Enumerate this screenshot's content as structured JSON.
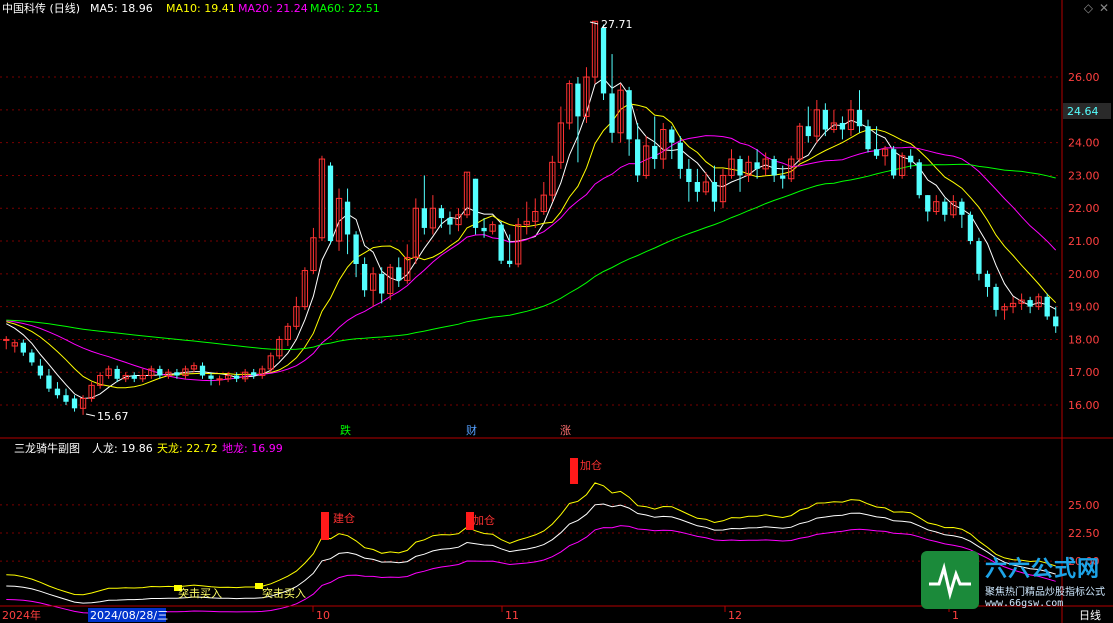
{
  "header": {
    "stock": "中国科传 (日线)",
    "ma5": "MA5: 18.96",
    "ma10": "MA10: 19.41",
    "ma20": "MA20: 21.24",
    "ma60": "MA60: 22.51"
  },
  "sub_header": {
    "name": "三龙骑牛副图",
    "renlong": "人龙: 19.86",
    "tianlong": "天龙: 22.72",
    "dilong": "地龙: 16.99"
  },
  "current_price": "24.64",
  "hi_label": "27.71",
  "lo_label": "15.67",
  "event_markers": [
    "跌",
    "财",
    "涨"
  ],
  "sub_markers": [
    "建仓",
    "加仓",
    "加仓"
  ],
  "buy_labels": [
    "突击买入",
    "突击买入"
  ],
  "axis_dates": [
    "2024年",
    "2024/08/28/三",
    "10",
    "11",
    "12",
    "1"
  ],
  "period_label": "日线",
  "watermark": {
    "title": "六六公式网",
    "subtitle": "聚焦热门精品炒股指标公式",
    "url": "www.66gsw.com"
  },
  "colors": {
    "up": "#ff3232",
    "down": "#54ffff",
    "ma5": "#ffffff",
    "ma10": "#ffff00",
    "ma20": "#ff00ff",
    "ma60": "#00ff00",
    "grid": "#7a0000",
    "axis": "#b40000"
  },
  "chart_data": [
    {
      "type": "candlestick",
      "ylim": [
        15.3,
        27.8
      ],
      "yticks": [
        "26.00",
        "25.00",
        "24.00",
        "23.00",
        "22.00",
        "21.00",
        "20.00",
        "19.00",
        "18.00",
        "17.00",
        "16.00"
      ],
      "candles": [
        [
          18.0,
          18.0,
          18.1,
          17.7
        ],
        [
          17.8,
          17.9,
          18.0,
          17.6
        ],
        [
          17.9,
          17.6,
          18.0,
          17.5
        ],
        [
          17.6,
          17.3,
          17.7,
          17.2
        ],
        [
          17.2,
          16.9,
          17.4,
          16.8
        ],
        [
          16.9,
          16.5,
          17.1,
          16.4
        ],
        [
          16.5,
          16.3,
          16.7,
          16.2
        ],
        [
          16.3,
          16.1,
          16.5,
          16.0
        ],
        [
          16.2,
          15.9,
          16.3,
          15.8
        ],
        [
          15.9,
          16.2,
          16.3,
          15.7
        ],
        [
          16.2,
          16.6,
          16.7,
          16.1
        ],
        [
          16.6,
          16.9,
          17.0,
          16.5
        ],
        [
          16.9,
          17.1,
          17.2,
          16.8
        ],
        [
          17.1,
          16.8,
          17.2,
          16.7
        ],
        [
          16.8,
          16.9,
          17.0,
          16.7
        ],
        [
          16.9,
          16.8,
          17.0,
          16.7
        ],
        [
          16.8,
          16.9,
          17.1,
          16.7
        ],
        [
          16.9,
          17.1,
          17.2,
          16.8
        ],
        [
          17.1,
          16.9,
          17.2,
          16.8
        ],
        [
          16.9,
          17.0,
          17.1,
          16.8
        ],
        [
          17.0,
          16.9,
          17.1,
          16.8
        ],
        [
          16.9,
          17.1,
          17.2,
          16.8
        ],
        [
          17.1,
          17.2,
          17.3,
          17.0
        ],
        [
          17.2,
          16.9,
          17.3,
          16.8
        ],
        [
          16.9,
          16.8,
          17.0,
          16.6
        ],
        [
          16.8,
          16.8,
          16.9,
          16.6
        ],
        [
          16.8,
          16.9,
          17.0,
          16.7
        ],
        [
          16.9,
          16.8,
          17.0,
          16.7
        ],
        [
          16.8,
          17.0,
          17.1,
          16.7
        ],
        [
          17.0,
          16.9,
          17.1,
          16.8
        ],
        [
          16.9,
          17.1,
          17.2,
          16.8
        ],
        [
          17.1,
          17.5,
          17.6,
          17.0
        ],
        [
          17.5,
          18.0,
          18.1,
          17.4
        ],
        [
          18.0,
          18.4,
          18.5,
          17.8
        ],
        [
          18.4,
          19.0,
          19.3,
          18.3
        ],
        [
          19.0,
          20.1,
          20.2,
          18.9
        ],
        [
          20.1,
          21.1,
          21.4,
          20.0
        ],
        [
          21.1,
          23.5,
          23.6,
          21.0
        ],
        [
          23.3,
          21.0,
          23.4,
          20.9
        ],
        [
          21.0,
          22.3,
          22.6,
          20.7
        ],
        [
          22.2,
          21.2,
          22.6,
          20.6
        ],
        [
          21.2,
          20.3,
          21.3,
          19.9
        ],
        [
          20.3,
          19.5,
          20.5,
          19.3
        ],
        [
          19.5,
          20.0,
          20.2,
          19.0
        ],
        [
          20.0,
          19.4,
          20.2,
          19.1
        ],
        [
          19.4,
          20.2,
          20.3,
          19.2
        ],
        [
          20.2,
          19.8,
          20.5,
          19.6
        ],
        [
          19.8,
          20.5,
          20.9,
          19.7
        ],
        [
          20.5,
          22.0,
          22.3,
          20.3
        ],
        [
          22.0,
          21.4,
          23.0,
          21.2
        ],
        [
          21.4,
          22.0,
          22.4,
          21.2
        ],
        [
          22.0,
          21.7,
          22.1,
          21.4
        ],
        [
          21.7,
          21.5,
          21.9,
          21.2
        ],
        [
          21.5,
          21.8,
          22.0,
          21.3
        ],
        [
          21.8,
          23.1,
          23.1,
          21.7
        ],
        [
          22.9,
          21.4,
          22.9,
          21.2
        ],
        [
          21.4,
          21.3,
          21.7,
          21.1
        ],
        [
          21.3,
          21.5,
          21.6,
          21.2
        ],
        [
          21.5,
          20.4,
          21.6,
          20.3
        ],
        [
          20.4,
          20.3,
          21.2,
          20.2
        ],
        [
          20.3,
          21.5,
          21.7,
          20.2
        ],
        [
          21.5,
          21.6,
          22.2,
          21.2
        ],
        [
          21.6,
          21.9,
          22.3,
          21.4
        ],
        [
          21.9,
          22.4,
          22.8,
          21.8
        ],
        [
          22.4,
          23.4,
          23.6,
          22.2
        ],
        [
          23.4,
          24.6,
          25.1,
          23.2
        ],
        [
          24.6,
          25.8,
          25.9,
          24.4
        ],
        [
          25.8,
          24.8,
          26.0,
          23.4
        ],
        [
          24.8,
          26.0,
          26.3,
          24.6
        ],
        [
          26.0,
          27.7,
          27.7,
          25.8
        ],
        [
          27.5,
          25.5,
          27.6,
          25.3
        ],
        [
          25.5,
          24.3,
          26.7,
          24.0
        ],
        [
          24.3,
          25.6,
          25.8,
          24.0
        ],
        [
          25.6,
          24.1,
          25.7,
          23.6
        ],
        [
          24.1,
          23.0,
          24.6,
          22.8
        ],
        [
          23.0,
          23.9,
          24.2,
          22.9
        ],
        [
          23.9,
          23.5,
          24.8,
          23.2
        ],
        [
          23.5,
          24.4,
          24.6,
          23.2
        ],
        [
          24.4,
          24.0,
          24.5,
          23.5
        ],
        [
          24.0,
          23.2,
          24.2,
          22.9
        ],
        [
          23.2,
          22.8,
          23.5,
          22.2
        ],
        [
          22.8,
          22.5,
          23.2,
          22.2
        ],
        [
          22.5,
          22.8,
          23.1,
          22.4
        ],
        [
          22.8,
          22.2,
          23.3,
          21.9
        ],
        [
          22.2,
          23.0,
          23.2,
          22.0
        ],
        [
          23.0,
          23.5,
          23.8,
          22.9
        ],
        [
          23.5,
          23.0,
          23.6,
          22.5
        ],
        [
          23.0,
          23.4,
          23.6,
          22.8
        ],
        [
          23.4,
          23.2,
          23.8,
          22.9
        ],
        [
          23.2,
          23.5,
          23.7,
          23.0
        ],
        [
          23.5,
          23.0,
          23.6,
          22.8
        ],
        [
          23.0,
          22.9,
          23.3,
          22.6
        ],
        [
          22.9,
          23.5,
          23.6,
          22.8
        ],
        [
          23.5,
          24.5,
          24.6,
          23.4
        ],
        [
          24.5,
          24.2,
          25.1,
          24.0
        ],
        [
          24.2,
          25.0,
          25.3,
          24.0
        ],
        [
          25.0,
          24.4,
          25.2,
          24.2
        ],
        [
          24.4,
          24.6,
          25.0,
          24.3
        ],
        [
          24.6,
          24.4,
          24.8,
          24.1
        ],
        [
          24.4,
          25.0,
          25.3,
          24.2
        ],
        [
          25.0,
          24.5,
          25.6,
          24.3
        ],
        [
          24.5,
          23.8,
          24.7,
          23.7
        ],
        [
          23.8,
          23.6,
          24.5,
          23.5
        ],
        [
          23.6,
          23.8,
          23.9,
          23.3
        ],
        [
          23.8,
          23.0,
          23.9,
          22.9
        ],
        [
          23.0,
          23.6,
          23.7,
          22.9
        ],
        [
          23.6,
          23.4,
          23.8,
          23.2
        ],
        [
          23.4,
          22.4,
          23.5,
          22.3
        ],
        [
          22.4,
          21.9,
          22.4,
          21.6
        ],
        [
          21.9,
          22.2,
          22.4,
          21.8
        ],
        [
          22.2,
          21.8,
          22.3,
          21.6
        ],
        [
          21.8,
          22.2,
          22.4,
          21.7
        ],
        [
          22.2,
          21.8,
          22.3,
          21.4
        ],
        [
          21.8,
          21.0,
          21.9,
          20.9
        ],
        [
          21.0,
          20.0,
          21.1,
          19.8
        ],
        [
          20.0,
          19.6,
          20.1,
          19.3
        ],
        [
          19.6,
          18.9,
          19.7,
          18.7
        ],
        [
          18.9,
          19.0,
          19.1,
          18.6
        ],
        [
          19.0,
          19.1,
          19.3,
          18.8
        ],
        [
          19.1,
          19.2,
          19.4,
          18.9
        ],
        [
          19.2,
          19.0,
          19.3,
          18.8
        ],
        [
          19.0,
          19.3,
          19.4,
          18.9
        ],
        [
          19.3,
          18.7,
          19.4,
          18.6
        ],
        [
          18.7,
          18.4,
          19.0,
          18.2
        ]
      ]
    },
    {
      "type": "line",
      "ylim": [
        16.2,
        28.8
      ],
      "yticks": [
        "25.00",
        "22.50",
        "20.00"
      ]
    }
  ]
}
